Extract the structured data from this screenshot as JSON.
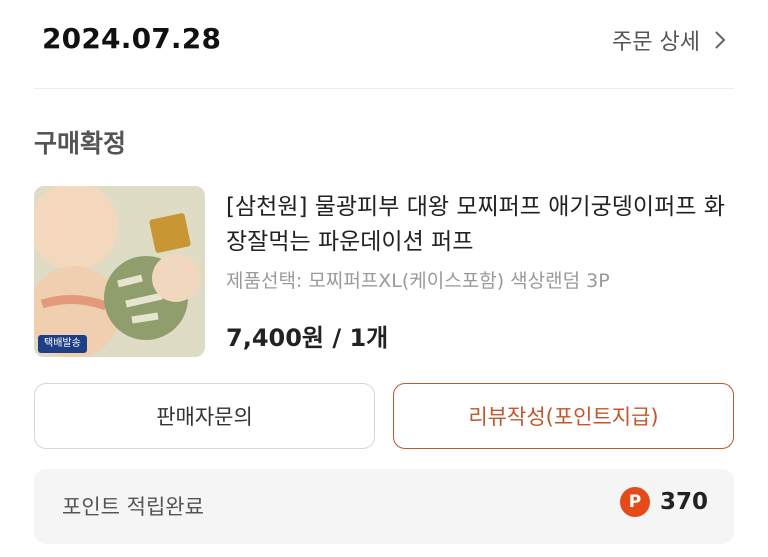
{
  "header": {
    "date": "2024.07.28",
    "detail_link": "주문 상세"
  },
  "order": {
    "status": "구매확정",
    "product": {
      "name": "[삼천원] 물광피부 대왕 모찌퍼프 애기궁뎅이퍼프 화장잘먹는 파운데이션 퍼프",
      "option": "제품선택: 모찌퍼프XL(케이스포함) 색상랜덤 3P",
      "price": "7,400원 / 1개",
      "thumbnail_badge": "택배발송"
    }
  },
  "buttons": {
    "inquiry": "판매자문의",
    "review": "리뷰작성(포인트지급)"
  },
  "points": {
    "label": "포인트 적립완료",
    "icon_letter": "P",
    "value": "370"
  },
  "colors": {
    "accent": "#c2562c",
    "point_coin": "#e64a19",
    "panel_bg": "#f5f5f5"
  }
}
